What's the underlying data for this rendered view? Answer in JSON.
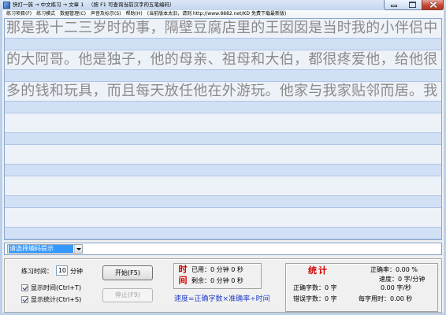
{
  "window": {
    "title": "快打一族 → 中文练习 → 文章 1",
    "hint": "（按 F1 可查询当前汉字的五笔编码）",
    "icons": {
      "app": "app-icon",
      "minimize": "minimize-icon",
      "maximize": "maximize-icon",
      "close": "close-icon"
    }
  },
  "menu": {
    "items": [
      "练习项目(F)",
      "练习模式",
      "数据管理(C)",
      "声音及标示(S)",
      "帮助(H)"
    ],
    "notice": "(当前版本太旧，请到 http://www.8882.net/KD 免费下载最新版)"
  },
  "practice": {
    "lines": [
      {
        "text": "那是我十二三岁时的事，隔壁豆腐店里的王囡囡是当时我的小伴侣中"
      },
      {
        "text": "的大阿哥。他是独子，他的母亲、祖母和大伯，都很疼爱他，给他很"
      },
      {
        "text": "多的钱和玩具，而且每天放任他在外游玩。他家与我家贴邻而居。我"
      }
    ]
  },
  "encoding_hint": {
    "selected": "请选择编码提示",
    "icon": "chevron-down-icon"
  },
  "settings": {
    "time_label": "练习时间：",
    "time_minutes": "10",
    "time_unit": "分钟",
    "show_time": {
      "label": "显示时间(Ctrl+T)",
      "checked": true
    },
    "show_stats": {
      "label": "显示统计(Ctrl+S)",
      "checked": true
    }
  },
  "actions": {
    "start": {
      "label": "开始(F5)"
    },
    "stop": {
      "label": "停止(F9)",
      "disabled": true
    }
  },
  "timer": {
    "title": "时间",
    "used": {
      "label": "已用：",
      "minutes": "0",
      "minute_unit": "分钟",
      "seconds": "0",
      "second_unit": "秒"
    },
    "remaining": {
      "label": "剩余：",
      "minutes": "0",
      "minute_unit": "分钟",
      "seconds": "0",
      "second_unit": "秒"
    }
  },
  "formula": "速度=正确字数×准确率÷时间",
  "stats": {
    "title": "统计",
    "accuracy": {
      "label": "正确率：",
      "value": "0.00",
      "unit": "%"
    },
    "speed_per_minute": {
      "label": "速度：",
      "value": "0",
      "unit": "字/分钟"
    },
    "speed_per_second": {
      "value": "0.00",
      "unit": "字/秒"
    },
    "correct_chars": {
      "label": "正确字数：",
      "value": "0",
      "unit": "字"
    },
    "error_chars": {
      "label": "错误字数：",
      "value": "0",
      "unit": "字"
    },
    "per_char_time": {
      "label": "每字用时：",
      "value": "0.00",
      "unit": "秒"
    }
  },
  "colors": {
    "source_text": "#8a8a8a",
    "label_red": "#d00000",
    "formula_blue": "#2140c8",
    "selection_blue": "#3399ff",
    "close_button": "#c4432f"
  }
}
